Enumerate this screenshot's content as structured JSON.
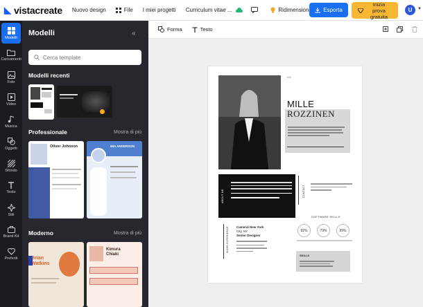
{
  "app": {
    "brand": "vistacreate"
  },
  "topbar": {
    "new_design": "Nuovo design",
    "file": "File",
    "my_projects": "I miei progetti",
    "doc_title": "Curriculum vitae ...",
    "resize": "Ridimensiona",
    "export": "Esporta",
    "trial": "Inizia prova gratuita",
    "avatar_initial": "U"
  },
  "rail": {
    "items": [
      {
        "label": "Modelli",
        "icon": "templates-icon"
      },
      {
        "label": "Caricamenti",
        "icon": "folder-icon"
      },
      {
        "label": "Foto",
        "icon": "photo-icon"
      },
      {
        "label": "Video",
        "icon": "video-icon"
      },
      {
        "label": "Musica",
        "icon": "music-icon"
      },
      {
        "label": "Oggetti",
        "icon": "objects-icon"
      },
      {
        "label": "Sfondo",
        "icon": "background-icon"
      },
      {
        "label": "Testo",
        "icon": "text-icon"
      },
      {
        "label": "Stili",
        "icon": "styles-icon"
      },
      {
        "label": "Brand Kit",
        "icon": "briefcase-icon"
      },
      {
        "label": "Preferiti",
        "icon": "heart-icon"
      }
    ]
  },
  "panel": {
    "title": "Modelli",
    "search_placeholder": "Cerca template",
    "recent_title": "Modelli recenti",
    "pro_title": "Professionale",
    "pro_more": "Mostra di più",
    "modern_title": "Moderno",
    "modern_more": "Mostra di più",
    "pro_thumb1_name": "Oliver Johnson",
    "pro_thumb2_name": "MIA ANDERSON",
    "modern_thumb1_name": "Brian Watkins",
    "modern_thumb2_name": "Kimura Chiaki"
  },
  "ctx": {
    "shape": "Forma",
    "text": "Testo"
  },
  "document": {
    "cv": "CV",
    "first_name": "MILLE",
    "last_name": "ROZZINEN",
    "about_label": "ABOUT ME",
    "contact_label": "CONTACT",
    "experience_label": "WORK EXPERIENCE",
    "job_company": "Cameral New York",
    "job_city": "City, NY",
    "job_title": "Senior Designer",
    "skills_title": "SOFTWARE SKILLS",
    "skill1": "92%",
    "skill2": "79%",
    "skill3": "99%",
    "skills_box_title": "SKILLS"
  },
  "colors": {
    "accent": "#1a6ff0",
    "trial": "#f7b733",
    "panel": "#27282e",
    "rail": "#1b1c21"
  }
}
